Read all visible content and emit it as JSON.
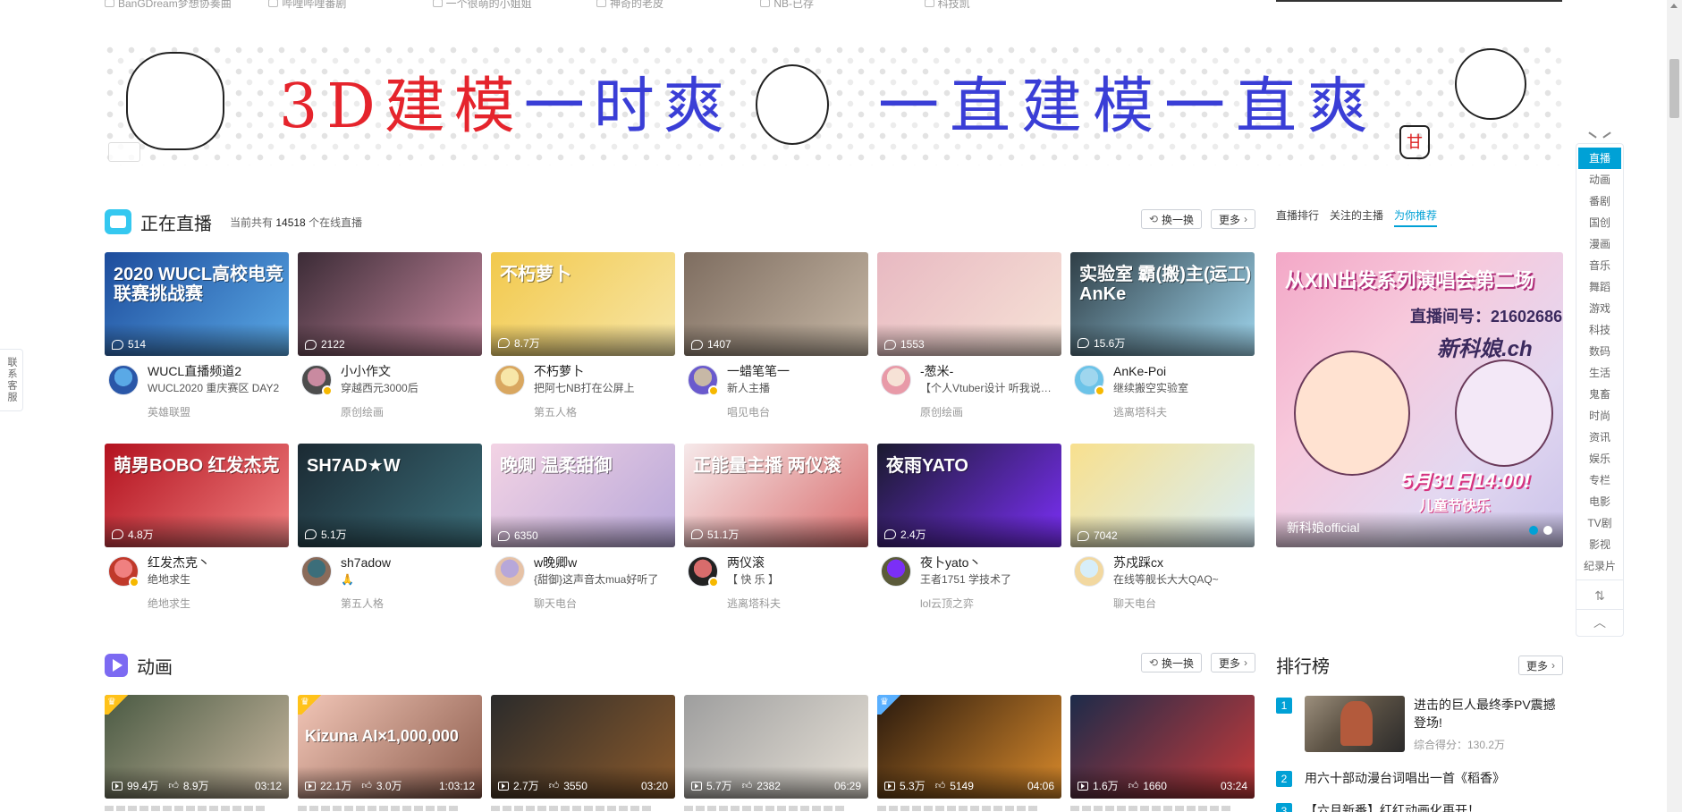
{
  "top_row": {
    "items": [
      "BanGDream梦想协奏曲",
      "哔哩哔哩番剧",
      "一个很萌的小姐姐",
      "神奇的老皮",
      "NB-已存",
      "科技凯"
    ]
  },
  "banner": {
    "text_red": "3D建模",
    "text_blue_a": "一时爽",
    "text_blue_b": "一直建模一直爽",
    "stamp_char": "甘"
  },
  "live_section": {
    "title": "正在直播",
    "subtitle_prefix": "当前共有",
    "count": "14518",
    "subtitle_suffix": "个在线直播",
    "refresh_label": "换一换",
    "more_label": "更多",
    "cards": [
      {
        "cover_title": "2020 WUCL高校电竞 联赛挑战赛",
        "viewers": "514",
        "uname": "WUCL直播频道2",
        "title": "WUCL2020 重庆赛区 DAY2",
        "area": "英雄联盟",
        "color_a": "#1d4c9c",
        "color_b": "#5aa9e6",
        "avatar": "#2a57a8",
        "badge": false
      },
      {
        "cover_title": "",
        "viewers": "2122",
        "uname": "小小作文",
        "title": "穿越西元3000后",
        "area": "原创绘画",
        "color_a": "#3b2b36",
        "color_b": "#c98aa0",
        "avatar": "#4d4d4d",
        "badge": true
      },
      {
        "cover_title": "不朽萝卜",
        "viewers": "8.7万",
        "uname": "不朽萝卜",
        "title": "把阿七NB打在公屏上",
        "area": "第五人格",
        "color_a": "#f2c94c",
        "color_b": "#f7e6a8",
        "avatar": "#d9a760",
        "badge": false
      },
      {
        "cover_title": "",
        "viewers": "1407",
        "uname": "一蜡笔笔一",
        "title": "新人主播",
        "area": "唱见电台",
        "color_a": "#7e6d60",
        "color_b": "#c7b8a6",
        "avatar": "#6a5acd",
        "badge": true
      },
      {
        "cover_title": "",
        "viewers": "1553",
        "uname": "-葱米-",
        "title": "【个人Vtuber设计 听我说说】葱米の…",
        "area": "原创绘画",
        "color_a": "#e8b9c2",
        "color_b": "#f6e2d6",
        "avatar": "#e89aa8",
        "badge": false
      },
      {
        "cover_title": "实验室 霸(搬)主(运工) AnKe",
        "viewers": "15.6万",
        "uname": "AnKe-Poi",
        "title": "继续搬空实验室",
        "area": "逃离塔科夫",
        "color_a": "#2f3e46",
        "color_b": "#9fd6ee",
        "avatar": "#6cc3e8",
        "badge": true
      },
      {
        "cover_title": "萌男BOBO 红发杰克",
        "viewers": "4.8万",
        "uname": "红发杰克丶",
        "title": "绝地求生",
        "area": "绝地求生",
        "color_a": "#b3121f",
        "color_b": "#f08080",
        "avatar": "#c0392b",
        "badge": true
      },
      {
        "cover_title": "SH7AD★W",
        "viewers": "5.1万",
        "uname": "sh7adow",
        "title": "🙏",
        "area": "第五人格",
        "color_a": "#1b2a33",
        "color_b": "#3c6e7a",
        "avatar": "#8a6b5a",
        "badge": false
      },
      {
        "cover_title": "晚卿 温柔甜御",
        "viewers": "6350",
        "uname": "w晚卿w",
        "title": "{甜御}这声音太mua好听了",
        "area": "聊天电台",
        "color_a": "#f3d3e4",
        "color_b": "#b7a7d9",
        "avatar": "#e6c2a6",
        "badge": false
      },
      {
        "cover_title": "正能量主播 两仪滚",
        "viewers": "51.1万",
        "uname": "两仪滚",
        "title": "【 快 乐 】",
        "area": "逃离塔科夫",
        "color_a": "#f6e9ea",
        "color_b": "#d86c6c",
        "avatar": "#222222",
        "badge": true
      },
      {
        "cover_title": "夜雨YATO",
        "viewers": "2.4万",
        "uname": "夜卜yato丶",
        "title": "王者1751 学技术了",
        "area": "lol云顶之弈",
        "color_a": "#1a1a2e",
        "color_b": "#7b2ff7",
        "avatar": "#5b5b3a",
        "badge": false
      },
      {
        "cover_title": "",
        "viewers": "7042",
        "uname": "苏戍踩cx",
        "title": "在线等舰长大大QAQ~",
        "area": "聊天电台",
        "color_a": "#f8e08e",
        "color_b": "#d7eef9",
        "avatar": "#f2d8a0",
        "badge": false
      }
    ]
  },
  "right_live": {
    "tabs": [
      "直播排行",
      "关注的主播",
      "为你推荐"
    ],
    "active_tab": "为你推荐",
    "line1": "从XIN出发系列演唱会第二场",
    "line2": "直播间号：21602686",
    "line3": "新科娘.ch",
    "line4": "5月31日14:00!",
    "line5": "儿童节快乐",
    "name": "新科娘official"
  },
  "anime_section": {
    "title": "动画",
    "refresh_label": "换一换",
    "more_label": "更多",
    "videos": [
      {
        "plays": "99.4万",
        "likes": "8.9万",
        "dur": "03:12",
        "crown": "gold",
        "cover_title": "",
        "color_a": "#4a5a43",
        "color_b": "#c9b8a0"
      },
      {
        "plays": "22.1万",
        "likes": "3.0万",
        "dur": "1:03:12",
        "crown": "gold",
        "cover_title": "Kizuna AI×1,000,000",
        "color_a": "#f2c6b7",
        "color_b": "#8a5a4a"
      },
      {
        "plays": "2.7万",
        "likes": "3550",
        "dur": "03:20",
        "crown": "",
        "cover_title": "",
        "color_a": "#2b2b2b",
        "color_b": "#8b5a2b"
      },
      {
        "plays": "5.7万",
        "likes": "2382",
        "dur": "06:29",
        "crown": "",
        "cover_title": "",
        "color_a": "#9e9e9e",
        "color_b": "#e8e2d8"
      },
      {
        "plays": "5.3万",
        "likes": "5149",
        "dur": "04:06",
        "crown": "blue",
        "cover_title": "",
        "color_a": "#2a1a0e",
        "color_b": "#d98a2b"
      },
      {
        "plays": "1.6万",
        "likes": "1660",
        "dur": "03:24",
        "crown": "",
        "cover_title": "",
        "color_a": "#1d2b4a",
        "color_b": "#c73a3a"
      }
    ]
  },
  "rank": {
    "title": "排行榜",
    "more_label": "更多",
    "items": [
      {
        "num": "1",
        "title": "进击的巨人最终季PV震撼登场!",
        "score": "综合得分：130.2万"
      },
      {
        "num": "2",
        "title": "用六十部动漫台词唱出一首《稻香》"
      },
      {
        "num": "3",
        "title": "【六月新番】红红动画化再开！"
      }
    ]
  },
  "vnav": {
    "items": [
      "直播",
      "动画",
      "番剧",
      "国创",
      "漫画",
      "音乐",
      "舞蹈",
      "游戏",
      "科技",
      "数码",
      "生活",
      "鬼畜",
      "时尚",
      "资讯",
      "娱乐",
      "专栏",
      "电影",
      "TV剧",
      "影视",
      "纪录片"
    ],
    "sort_glyph": "⇅",
    "top_glyph": "︿"
  },
  "contact": {
    "label": "联系客服"
  }
}
